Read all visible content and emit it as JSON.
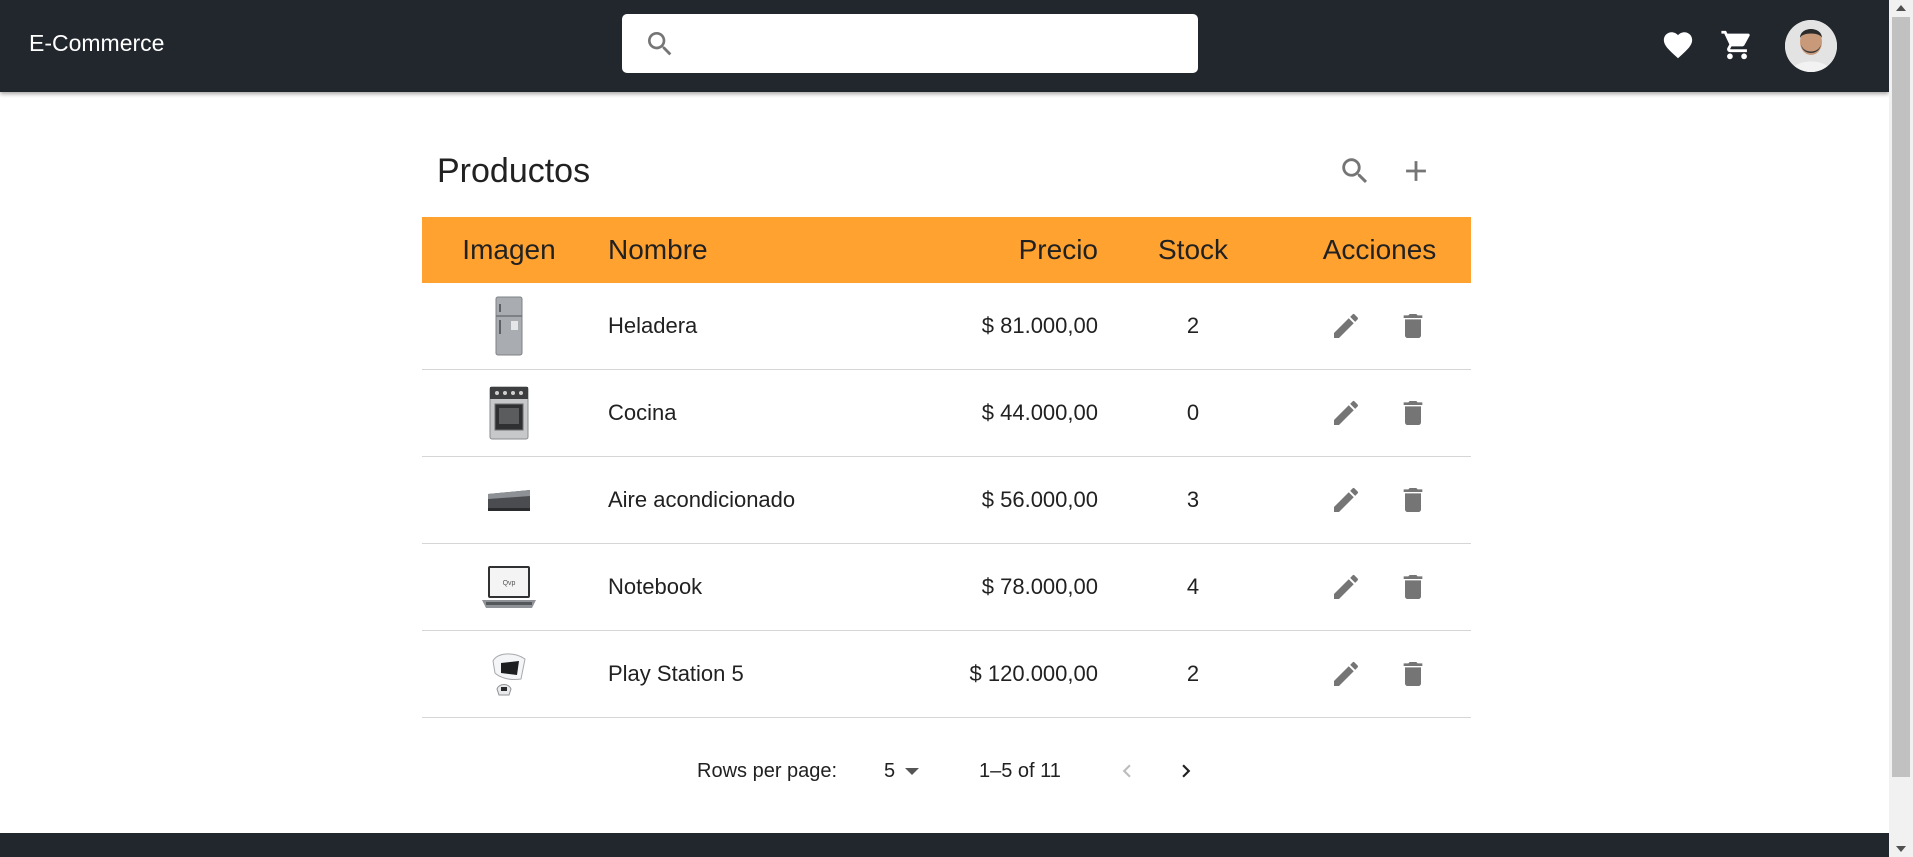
{
  "appbar": {
    "brand": "E-Commerce",
    "search_placeholder": "",
    "icons": [
      "search-icon",
      "heart-icon",
      "cart-icon",
      "avatar"
    ]
  },
  "panel": {
    "title": "Productos",
    "tools": [
      "search-icon",
      "add-icon"
    ]
  },
  "table": {
    "headers": {
      "image": "Imagen",
      "name": "Nombre",
      "price": "Precio",
      "stock": "Stock",
      "actions": "Acciones"
    },
    "rows": [
      {
        "name": "Heladera",
        "price": "$ 81.000,00",
        "stock": "2",
        "image": "fridge-image"
      },
      {
        "name": "Cocina",
        "price": "$ 44.000,00",
        "stock": "0",
        "image": "stove-image"
      },
      {
        "name": "Aire acondicionado",
        "price": "$ 56.000,00",
        "stock": "3",
        "image": "air-conditioner-image"
      },
      {
        "name": "Notebook",
        "price": "$ 78.000,00",
        "stock": "4",
        "image": "notebook-image"
      },
      {
        "name": "Play Station 5",
        "price": "$ 120.000,00",
        "stock": "2",
        "image": "playstation-image"
      }
    ],
    "row_actions": [
      "edit-icon",
      "delete-icon"
    ]
  },
  "pagination": {
    "rows_per_page_label": "Rows per page:",
    "rows_per_page_value": "5",
    "range_label": "1–5 of 11"
  },
  "colors": {
    "appbar": "#22272e",
    "table_header": "#ffa230",
    "icon_grey": "#757575"
  }
}
